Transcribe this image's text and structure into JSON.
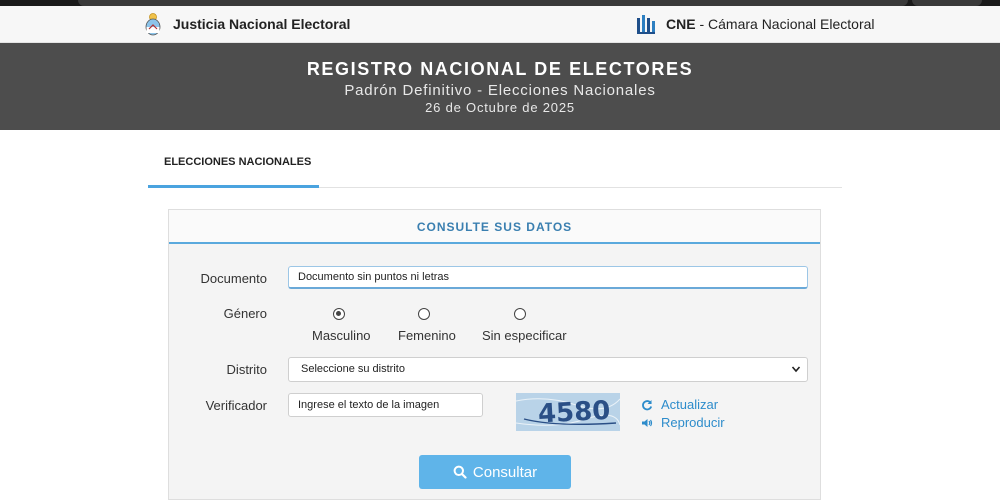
{
  "header": {
    "brand_left": "Justicia Nacional Electoral",
    "cne_abbr": "CNE",
    "cne_rest": "- Cámara Nacional Electoral"
  },
  "hero": {
    "title": "REGISTRO NACIONAL DE ELECTORES",
    "subtitle": "Padrón Definitivo - Elecciones Nacionales",
    "date": "26 de Octubre de 2025"
  },
  "tabs": [
    {
      "label": "ELECCIONES NACIONALES",
      "active": true
    }
  ],
  "form": {
    "title": "CONSULTE SUS DATOS",
    "documento": {
      "label": "Documento",
      "placeholder": "Documento sin puntos ni letras"
    },
    "genero": {
      "label": "Género",
      "options": [
        {
          "label": "Masculino",
          "checked": true
        },
        {
          "label": "Femenino",
          "checked": false
        },
        {
          "label": "Sin especificar",
          "checked": false
        }
      ]
    },
    "distrito": {
      "label": "Distrito",
      "selected": "Seleccione su distrito"
    },
    "verificador": {
      "label": "Verificador",
      "placeholder": "Ingrese el texto de la imagen",
      "captcha_text": "4580",
      "refresh_label": "Actualizar",
      "audio_label": "Reproducir"
    },
    "submit_label": "Consultar"
  },
  "colors": {
    "hero_bg": "#4d4d4d",
    "accent": "#4aa3df",
    "link": "#2d8ccb",
    "button": "#5fb4e9"
  }
}
